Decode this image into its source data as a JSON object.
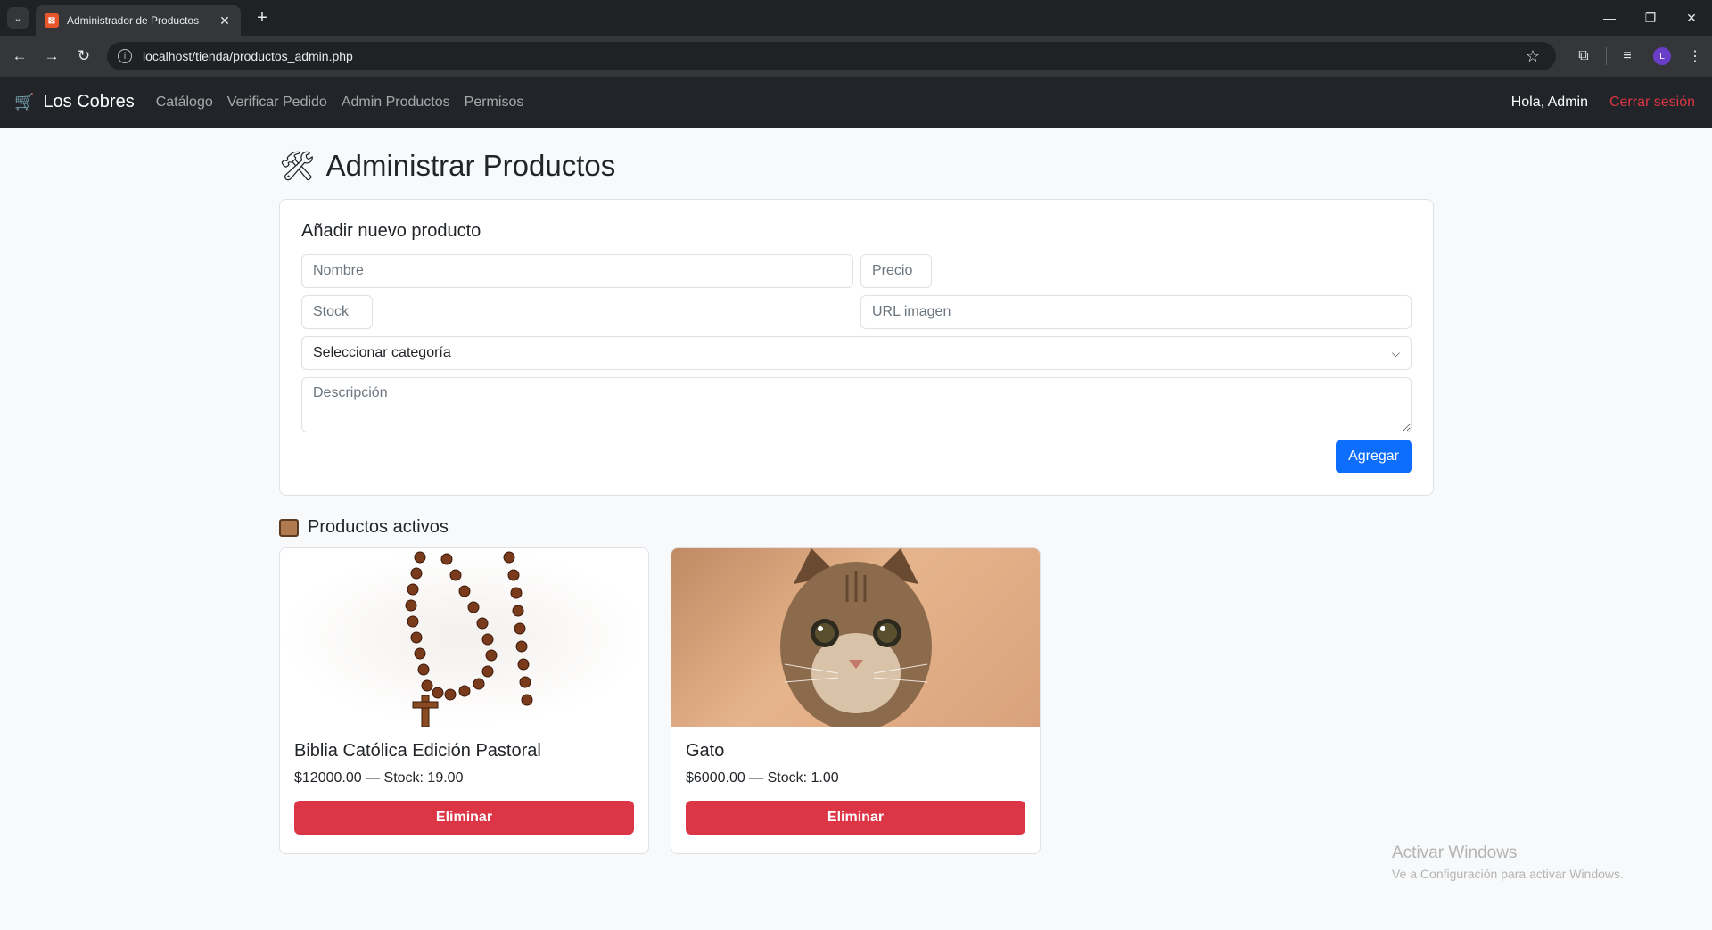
{
  "browser": {
    "tab_title": "Administrador de Productos",
    "url": "localhost/tienda/productos_admin.php",
    "profile_initial": "L"
  },
  "navbar": {
    "brand": "Los Cobres",
    "links": [
      {
        "label": "Catálogo"
      },
      {
        "label": "Verificar Pedido"
      },
      {
        "label": "Admin Productos"
      },
      {
        "label": "Permisos"
      }
    ],
    "greeting": "Hola, Admin",
    "logout": "Cerrar sesión"
  },
  "page": {
    "title": "Administrar Productos"
  },
  "form": {
    "title": "Añadir nuevo producto",
    "name_placeholder": "Nombre",
    "price_placeholder": "Precio",
    "stock_placeholder": "Stock",
    "image_placeholder": "URL imagen",
    "category_selected": "Seleccionar categoría",
    "description_placeholder": "Descripción",
    "submit_label": "Agregar"
  },
  "products_section": {
    "title": "Productos activos",
    "items": [
      {
        "name": "Biblia Católica Edición Pastoral",
        "meta": "$12000.00 — Stock: 19.00",
        "delete_label": "Eliminar"
      },
      {
        "name": "Gato",
        "meta": "$6000.00 — Stock: 1.00",
        "delete_label": "Eliminar"
      }
    ]
  },
  "watermark": {
    "title": "Activar Windows",
    "subtitle": "Ve a Configuración para activar Windows."
  }
}
